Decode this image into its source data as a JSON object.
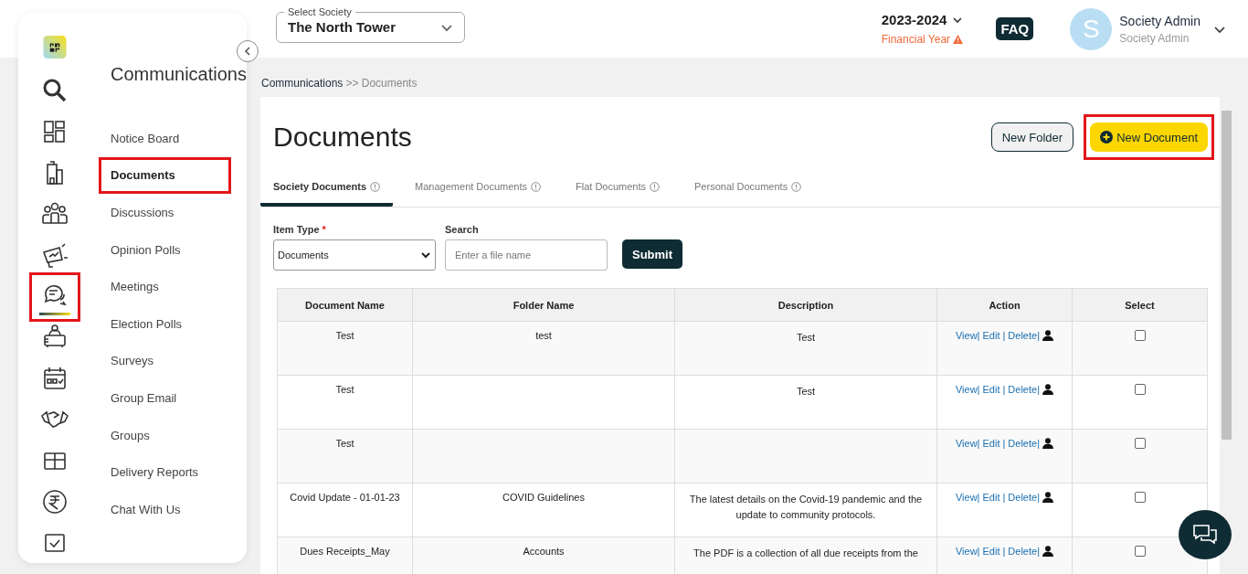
{
  "rail": [
    {
      "kind": "search",
      "selected": false,
      "highlighted": false
    },
    {
      "kind": "dashboard",
      "selected": false,
      "highlighted": false
    },
    {
      "kind": "building",
      "selected": false,
      "highlighted": false
    },
    {
      "kind": "people",
      "selected": false,
      "highlighted": false
    },
    {
      "kind": "megaphone",
      "selected": false,
      "highlighted": false
    },
    {
      "kind": "chat",
      "selected": true,
      "highlighted": true
    },
    {
      "kind": "desk",
      "selected": false,
      "highlighted": false
    },
    {
      "kind": "calendar",
      "selected": false,
      "highlighted": false
    },
    {
      "kind": "handshake",
      "selected": false,
      "highlighted": false
    },
    {
      "kind": "box",
      "selected": false,
      "highlighted": false
    },
    {
      "kind": "rupee",
      "selected": false,
      "highlighted": false
    },
    {
      "kind": "checklist",
      "selected": false,
      "highlighted": false
    }
  ],
  "nav": {
    "title": "Communications",
    "items": [
      {
        "label": "Notice Board",
        "selected": false,
        "highlighted": false
      },
      {
        "label": "Documents",
        "selected": true,
        "highlighted": true
      },
      {
        "label": "Discussions",
        "selected": false,
        "highlighted": false
      },
      {
        "label": "Opinion Polls",
        "selected": false,
        "highlighted": false
      },
      {
        "label": "Meetings",
        "selected": false,
        "highlighted": false
      },
      {
        "label": "Election Polls",
        "selected": false,
        "highlighted": false
      },
      {
        "label": "Surveys",
        "selected": false,
        "highlighted": false
      },
      {
        "label": "Group Email",
        "selected": false,
        "highlighted": false
      },
      {
        "label": "Groups",
        "selected": false,
        "highlighted": false
      },
      {
        "label": "Delivery Reports",
        "selected": false,
        "highlighted": false
      },
      {
        "label": "Chat With Us",
        "selected": false,
        "highlighted": false
      }
    ]
  },
  "header": {
    "society_label": "Select Society",
    "society": "The North Tower",
    "year": "2023-2024",
    "year_caption": "Financial Year",
    "faq": "FAQ",
    "avatar_letter": "S",
    "user_name": "Society Admin",
    "user_role": "Society Admin"
  },
  "breadcrumb": {
    "parent": "Communications",
    "separator": ">>",
    "current": "Documents"
  },
  "page": {
    "title": "Documents",
    "buttons": [
      {
        "label": "New Folder",
        "kind": "outline",
        "highlighted": false
      },
      {
        "label": "New Document",
        "kind": "primary",
        "highlighted": true
      }
    ]
  },
  "tabs": [
    {
      "label": "Society Documents",
      "selected": true
    },
    {
      "label": "Management Documents",
      "selected": false
    },
    {
      "label": "Flat Documents",
      "selected": false
    },
    {
      "label": "Personal Documents",
      "selected": false
    }
  ],
  "filters": {
    "item_type_label": "Item Type",
    "required_mark": "*",
    "item_type": "Documents",
    "search_label": "Search",
    "search_placeholder": "Enter a file name",
    "submit": "Submit"
  },
  "table": {
    "columns": [
      "Document Name",
      "Folder Name",
      "Description",
      "Action",
      "Select"
    ],
    "rows": [
      {
        "name": "Test",
        "folder": "test",
        "description": "Test",
        "actions": [
          "View|",
          "Edit |",
          "Delete|"
        ],
        "checked": false
      },
      {
        "name": "Test",
        "folder": "",
        "description": "Test",
        "actions": [
          "View|",
          "Edit |",
          "Delete|"
        ],
        "checked": false
      },
      {
        "name": "Test",
        "folder": "",
        "description": "",
        "actions": [
          "View|",
          "Edit |",
          "Delete|"
        ],
        "checked": false
      },
      {
        "name": "Covid Update - 01-01-23",
        "folder": "COVID Guidelines",
        "description": "The latest details on the Covid-19 pandemic and the update to community protocols.",
        "actions": [
          "View|",
          "Edit |",
          "Delete|"
        ],
        "checked": false
      },
      {
        "name": "Dues Receipts_May",
        "folder": "Accounts",
        "description": "The PDF is a collection of all due receipts from the",
        "actions": [
          "View|",
          "Edit |",
          "Delete|"
        ],
        "checked": false
      }
    ]
  }
}
